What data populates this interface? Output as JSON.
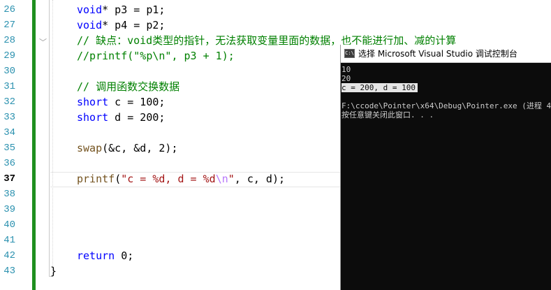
{
  "editor": {
    "active_line": "37",
    "lines": [
      {
        "num": "26",
        "tokens": [
          {
            "t": "void",
            "c": "kw"
          },
          {
            "t": "* p3 = p1;",
            "c": ""
          }
        ]
      },
      {
        "num": "27",
        "tokens": [
          {
            "t": "void",
            "c": "kw"
          },
          {
            "t": "* p4 = p2;",
            "c": ""
          }
        ]
      },
      {
        "num": "28",
        "tokens": [
          {
            "t": "// 缺点：void类型的指针，无法获取变量里面的数据，也不能进行加、减的计算",
            "c": "cm"
          }
        ]
      },
      {
        "num": "29",
        "tokens": [
          {
            "t": "//printf(\"%p\\n\", p3 + 1);",
            "c": "cm"
          }
        ]
      },
      {
        "num": "30",
        "tokens": []
      },
      {
        "num": "31",
        "tokens": [
          {
            "t": "// 调用函数交换数据",
            "c": "cm"
          }
        ]
      },
      {
        "num": "32",
        "tokens": [
          {
            "t": "short",
            "c": "kw"
          },
          {
            "t": " c = 100;",
            "c": ""
          }
        ]
      },
      {
        "num": "33",
        "tokens": [
          {
            "t": "short",
            "c": "kw"
          },
          {
            "t": " d = 200;",
            "c": ""
          }
        ]
      },
      {
        "num": "34",
        "tokens": []
      },
      {
        "num": "35",
        "tokens": [
          {
            "t": "swap",
            "c": "fn"
          },
          {
            "t": "(&c, &d, 2);",
            "c": ""
          }
        ]
      },
      {
        "num": "36",
        "tokens": []
      },
      {
        "num": "37",
        "tokens": [
          {
            "t": "printf",
            "c": "fn"
          },
          {
            "t": "(",
            "c": ""
          },
          {
            "t": "\"c = %d, d = %d",
            "c": "str"
          },
          {
            "t": "\\n",
            "c": "esc"
          },
          {
            "t": "\"",
            "c": "str"
          },
          {
            "t": ", c, d);",
            "c": ""
          }
        ]
      },
      {
        "num": "38",
        "tokens": []
      },
      {
        "num": "39",
        "tokens": []
      },
      {
        "num": "40",
        "tokens": []
      },
      {
        "num": "41",
        "tokens": []
      },
      {
        "num": "42",
        "tokens": [
          {
            "t": "return",
            "c": "kw"
          },
          {
            "t": " 0;",
            "c": ""
          }
        ]
      },
      {
        "num": "43",
        "tokens": [
          {
            "t": "}",
            "c": "brace"
          }
        ]
      }
    ]
  },
  "console": {
    "icon_label": "C:\\",
    "title": "选择 Microsoft Visual Studio 调试控制台",
    "output": [
      {
        "text": "10",
        "selected": false
      },
      {
        "text": "20",
        "selected": false
      },
      {
        "text": "c = 200, d = 100",
        "selected": true
      },
      {
        "text": "",
        "selected": false
      },
      {
        "text": "F:\\ccode\\Pointer\\x64\\Debug\\Pointer.exe (进程 4",
        "selected": false
      },
      {
        "text": "按任意键关闭此窗口. . .",
        "selected": false
      }
    ]
  }
}
